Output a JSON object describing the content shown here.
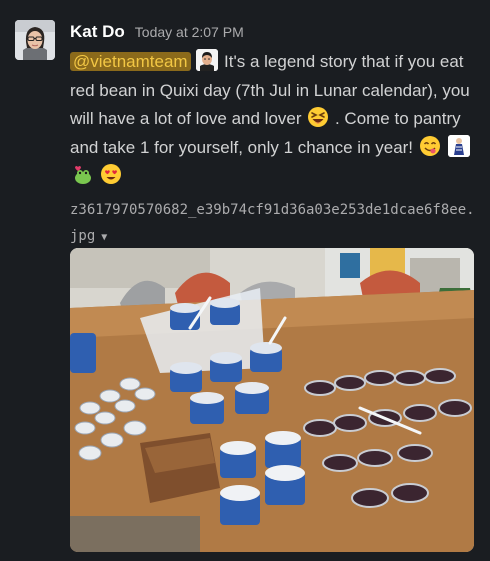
{
  "message": {
    "author": "Kat Do",
    "timestamp": "Today at 2:07 PM",
    "mention": "@vietnamteam",
    "text_part1": " It's a legend story that if you eat red bean in Quixi day (7th Jul in Lunar calendar), you will have a lot of love and lover ",
    "text_part2": " . Come to pantry and take 1 for yourself, only 1 chance in year! ",
    "emojis": [
      "laughing-emoji",
      "yum-emoji",
      "custom-couple-emoji",
      "kiss-emoji",
      "heart-eyes-emoji"
    ]
  },
  "attachment": {
    "filename": "z3617970570682_e39b74cf91d36a03e253de1dcae6f8ee.jpg",
    "caret": "▼"
  },
  "colors": {
    "background": "#1a1d21",
    "mention_bg": "#8b6a1b",
    "mention_fg": "#f2c744"
  }
}
